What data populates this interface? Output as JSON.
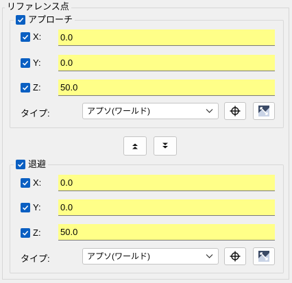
{
  "group_title": "リファレンス点",
  "approach": {
    "label": "アプローチ",
    "checked": true,
    "x": {
      "axis": "X:",
      "value": "0.0",
      "checked": true
    },
    "y": {
      "axis": "Y:",
      "value": "0.0",
      "checked": true
    },
    "z": {
      "axis": "Z:",
      "value": "50.0",
      "checked": true
    },
    "type_label": "タイプ:",
    "type_value": "アプソ(ワールド)"
  },
  "retract": {
    "label": "退避",
    "checked": true,
    "x": {
      "axis": "X:",
      "value": "0.0",
      "checked": true
    },
    "y": {
      "axis": "Y:",
      "value": "0.0",
      "checked": true
    },
    "z": {
      "axis": "Z:",
      "value": "50.0",
      "checked": true
    },
    "type_label": "タイプ:",
    "type_value": "アプソ(ワールド)"
  },
  "icons": {
    "checkbox": "checkmark-icon",
    "dropdown": "chevron-down-icon",
    "pick": "crosshair-icon",
    "measure": "measure-icon",
    "move_up": "double-chevron-up-icon",
    "move_down": "double-chevron-down-icon"
  },
  "colors": {
    "checkbox_fill": "#0a5fc2",
    "field_fill": "#ffff88",
    "background": "#f0f0f0"
  }
}
